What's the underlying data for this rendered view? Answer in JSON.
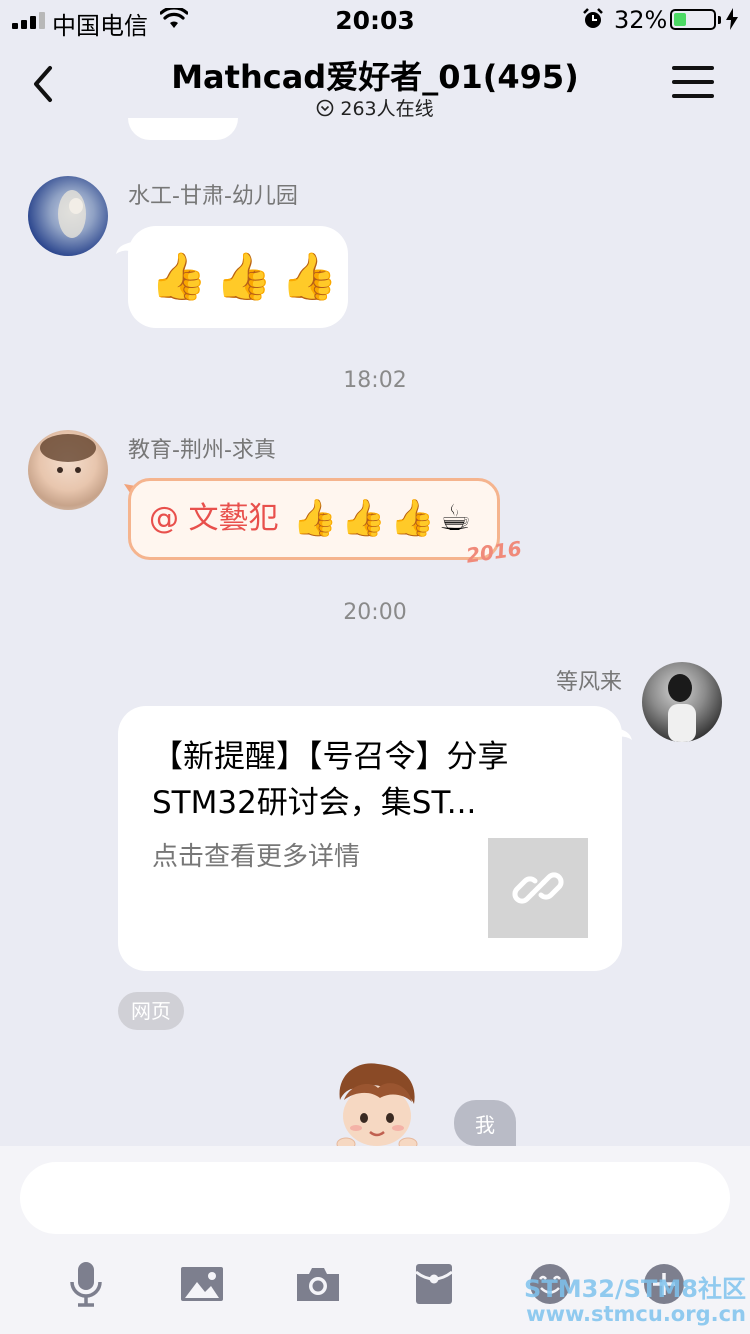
{
  "status_bar": {
    "carrier": "中国电信",
    "time": "20:03",
    "battery_percent_text": "32%",
    "battery_level": 0.32
  },
  "nav": {
    "title": "Mathcad爱好者_01(495)",
    "online_text": "263人在线"
  },
  "messages": [
    {
      "type": "emoji",
      "sender": "水工-甘肃-幼儿园",
      "emoji": [
        "👍",
        "👍",
        "👍"
      ]
    },
    {
      "type": "timestamp",
      "text": "18:02"
    },
    {
      "type": "mention",
      "sender": "教育-荆州-求真",
      "mention": "@ 文藝犯",
      "emoji": [
        "👍",
        "👍",
        "👍",
        "☕"
      ],
      "badge": "2016"
    },
    {
      "type": "timestamp",
      "text": "20:00"
    },
    {
      "type": "link_card",
      "sender": "等风来",
      "title": "【新提醒】【号召令】分享STM32研讨会，集ST...",
      "description": "点击查看更多详情",
      "tag": "网页"
    },
    {
      "type": "sticker",
      "label": "我"
    }
  ],
  "input": {
    "placeholder": ""
  },
  "toolbar": [
    "microphone-icon",
    "image-icon",
    "camera-icon",
    "red-packet-icon",
    "emoji-icon",
    "plus-icon"
  ],
  "watermark": {
    "line1": "STM32/STM8社区",
    "line2": "www.stmcu.org.cn"
  },
  "colors": {
    "background": "#eaebf3",
    "mention_text": "#e8504c",
    "battery": "#4cd964",
    "watermark": "#7fc3ee"
  }
}
